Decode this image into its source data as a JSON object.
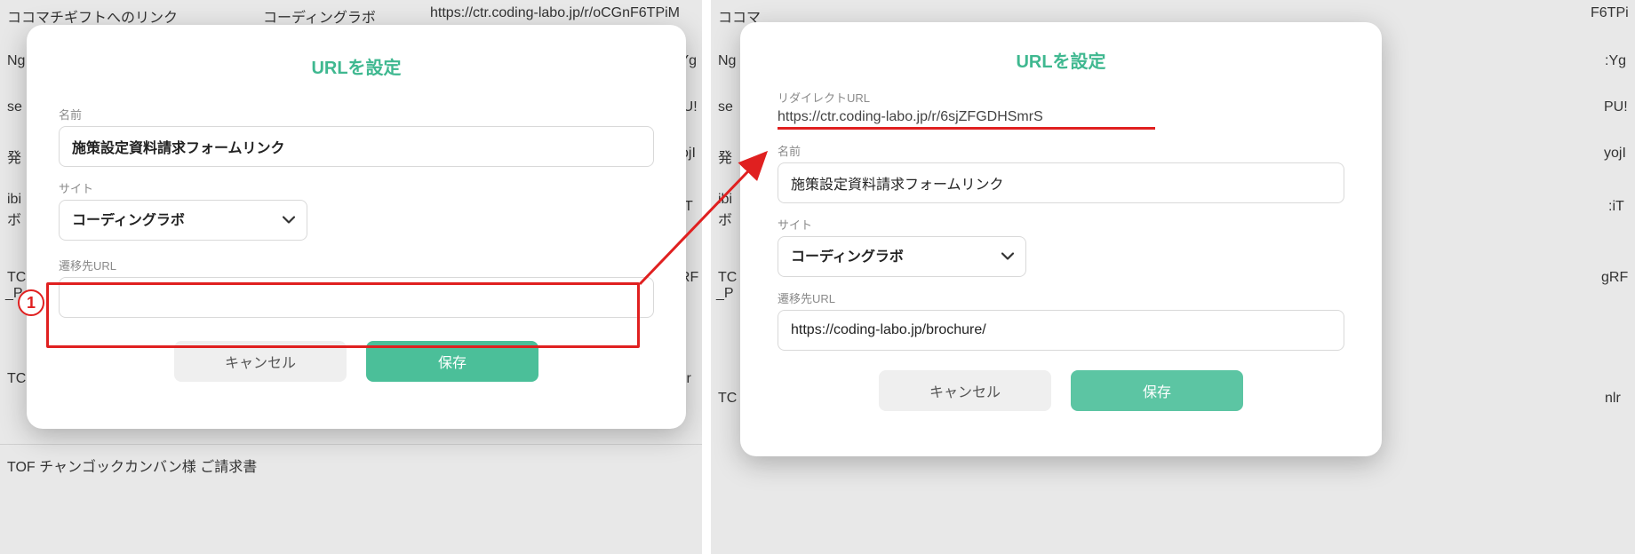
{
  "left": {
    "bg": {
      "row1_col1": "ココマチギフトへのリンク",
      "row1_col2": "コーディングラボ",
      "row1_col3": "https://ctr.coding-labo.jp/r/oCGnF6TPiM",
      "frag_ng": "Ng",
      "frag_yg": ":Yg",
      "frag_se": "se",
      "frag_pu": "PU!",
      "frag_hatsu": "発",
      "frag_yoj": "yojI",
      "frag_ibi": "ibi",
      "frag_bo": "ボ",
      "frag_it": ":iT",
      "frag_tc1": "TC",
      "frag_p1": "_P",
      "frag_grf": "gRF",
      "frag_tc2": "TC",
      "frag_nlr": "nlr",
      "row_last": "TOF チャンゴックカンバン様 ご請求書"
    },
    "modal": {
      "title": "URLを設定",
      "name_label": "名前",
      "name_value": "施策設定資料請求フォームリンク",
      "site_label": "サイト",
      "site_value": "コーディングラボ",
      "dest_label": "遷移先URL",
      "dest_value": "",
      "cancel": "キャンセル",
      "save": "保存"
    },
    "callout": {
      "num": "1"
    }
  },
  "right": {
    "bg": {
      "row1_col1": "ココマ",
      "row1_col4": "F6TPi",
      "frag_ng": "Ng",
      "frag_yg": ":Yg",
      "frag_se": "se",
      "frag_pu": "PU!",
      "frag_hatsu": "発",
      "frag_yoj": "yojI",
      "frag_ibi": "ibi",
      "frag_bo": "ボ",
      "frag_it": ":iT",
      "frag_tc1": "TC",
      "frag_p1": "_P",
      "frag_grf": "gRF",
      "frag_tc2": "TC",
      "frag_nlr": "nlr"
    },
    "modal": {
      "title": "URLを設定",
      "redirect_label": "リダイレクトURL",
      "redirect_value": "https://ctr.coding-labo.jp/r/6sjZFGDHSmrS",
      "name_label": "名前",
      "name_value": "施策設定資料請求フォームリンク",
      "site_label": "サイト",
      "site_value": "コーディングラボ",
      "dest_label": "遷移先URL",
      "dest_value": "https://coding-labo.jp/brochure/",
      "cancel": "キャンセル",
      "save": "保存"
    }
  }
}
